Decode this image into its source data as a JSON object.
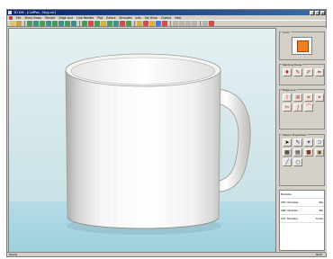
{
  "window": {
    "title": "3D KiN - [CoffPas - Mug.cer]",
    "buttons": [
      "_",
      "□",
      "×"
    ]
  },
  "menubar": [
    "File",
    "Show Views",
    "Render",
    "Edge Line",
    "Line Render",
    "Plot",
    "Eaters",
    "Simulate",
    "Info",
    "Set Hline",
    "Clotest",
    "Help"
  ],
  "panel": {
    "color_group_title": "Color",
    "current_color": "#f08020",
    "painting_group_title": "Painting Mode",
    "edge_group_title": "Edge Line",
    "object_group_title": "Object Properties",
    "list_rows": [
      {
        "name": "Modeller",
        "val": ""
      },
      {
        "name": "CFD: Modeller",
        "val": "Tab"
      },
      {
        "name": "ANT: Modeller",
        "val": "Tab"
      },
      {
        "name": "ACT: Modeller",
        "val": "Tuned"
      }
    ]
  },
  "statusbar": {
    "left": "Ready",
    "right": "NUM"
  }
}
